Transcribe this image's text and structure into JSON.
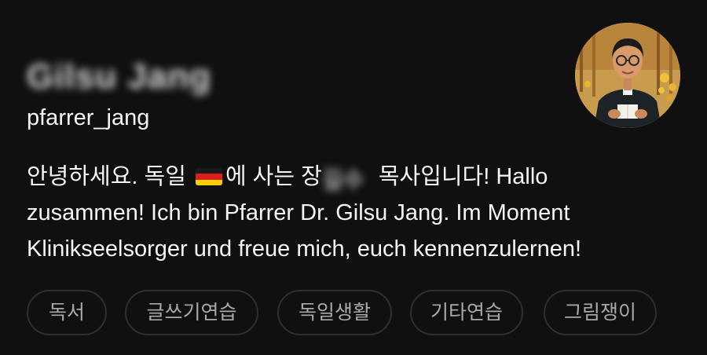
{
  "profile": {
    "display_name": "Gilsu Jang",
    "username": "pfarrer_jang",
    "avatar": "profile-avatar-illustration",
    "bio": {
      "line1_before_flag": "안녕하세요. 독일 ",
      "flag": "🇩🇪",
      "line1_after_flag": "에 사는 장",
      "redacted_text": "길수",
      "line1_end": " 목사입니다! Hallo",
      "line2": "zusammen! Ich bin Pfarrer Dr. Gilsu Jang. Im Moment",
      "line3": "Klinikseelsorger und freue mich, euch kennenzulernen!"
    },
    "tags": [
      "독서",
      "글쓰기연습",
      "독일생활",
      "기타연습",
      "그림쟁이"
    ]
  },
  "colors": {
    "background": "#101010",
    "text": "#f3f5f7",
    "tag_text": "#a9a9a9",
    "tag_border": "#2f2f2f"
  }
}
